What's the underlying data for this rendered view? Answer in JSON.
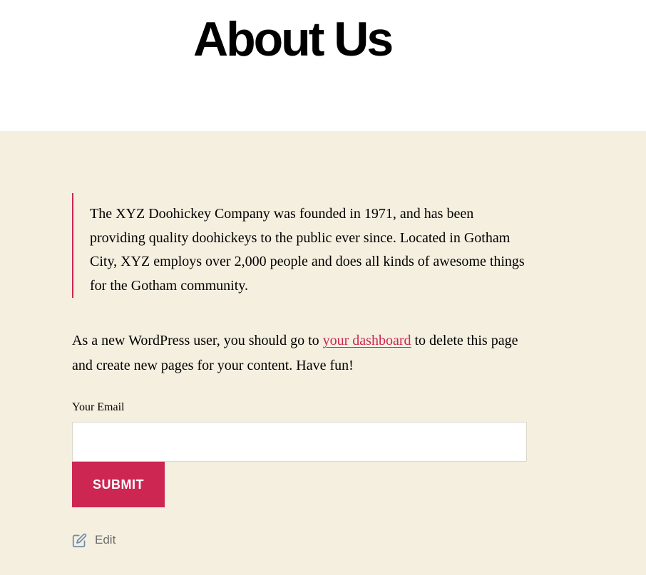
{
  "page": {
    "title": "About Us"
  },
  "quote": {
    "text": "The XYZ Doohickey Company was founded in 1971, and has been providing quality doohickeys to the public ever since. Located in Gotham City, XYZ employs over 2,000 people and does all kinds of awesome things for the Gotham community."
  },
  "intro": {
    "before": "As a new WordPress user, you should go to ",
    "link_text": "your dashboard",
    "after": " to delete this page and create new pages for your content. Have fun!"
  },
  "form": {
    "email_label": "Your Email",
    "email_value": "",
    "submit_label": "SUBMIT"
  },
  "edit": {
    "label": "Edit",
    "icon": "edit-icon"
  },
  "colors": {
    "accent": "#cd2653",
    "content_background": "#f5efe0",
    "header_background": "#ffffff",
    "text": "#000000",
    "muted": "#6d6d6d"
  }
}
